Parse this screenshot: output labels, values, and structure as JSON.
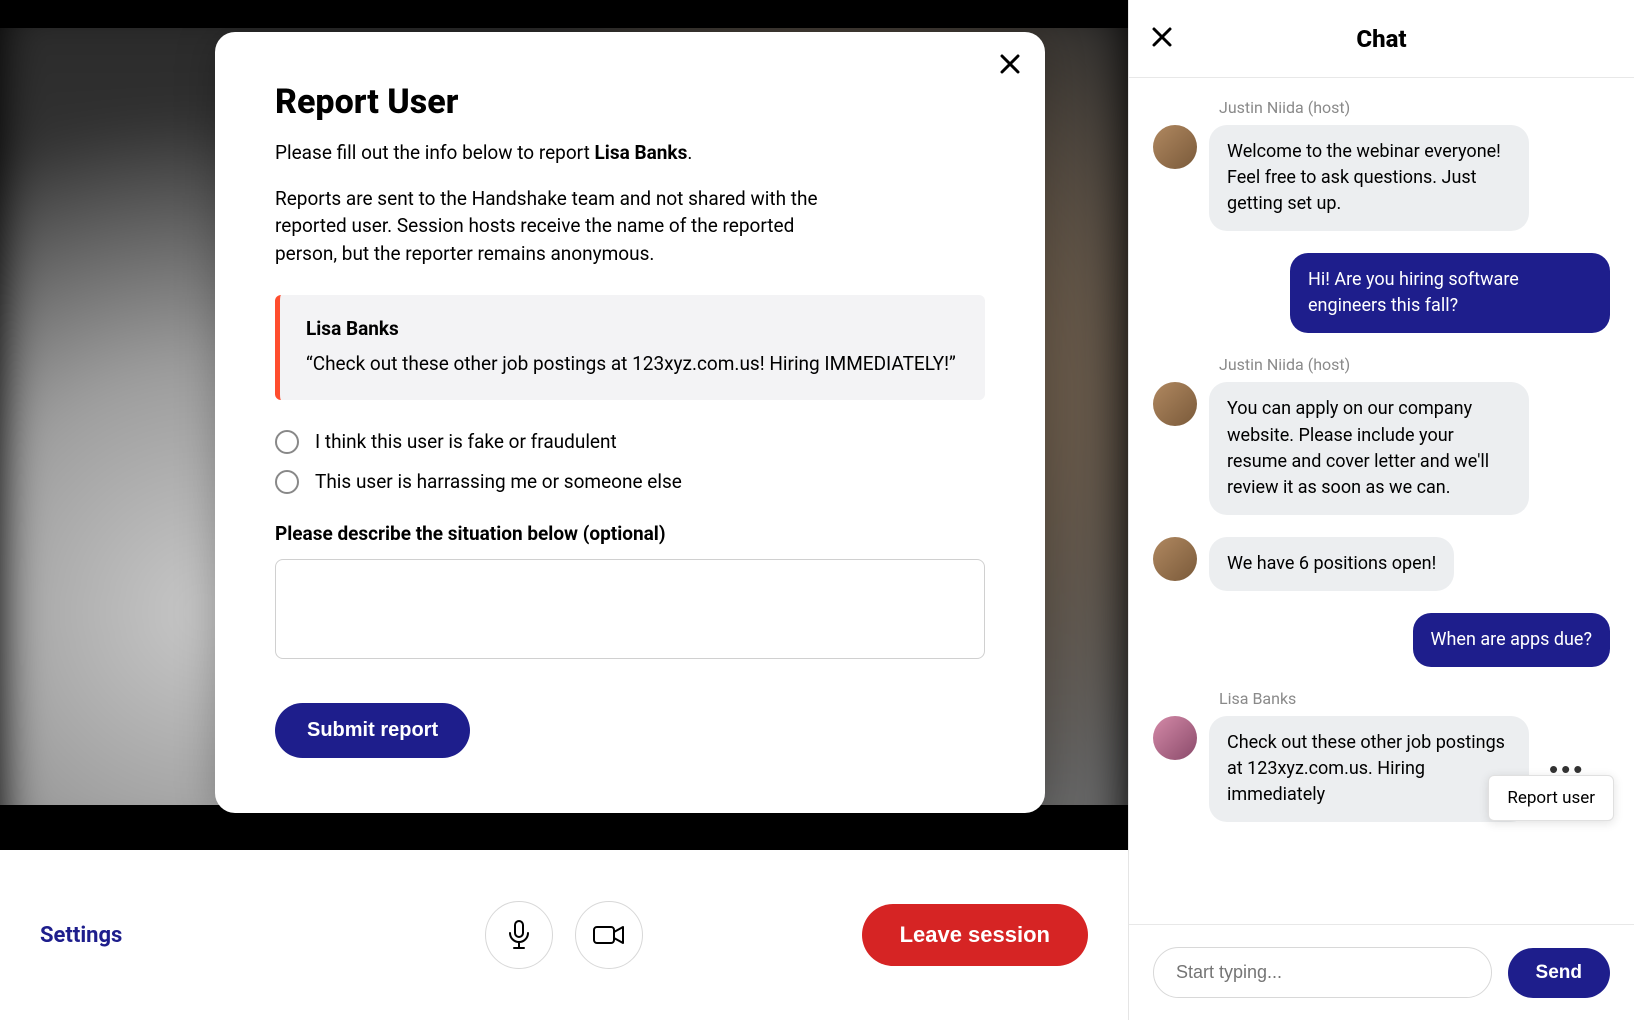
{
  "modal": {
    "title": "Report User",
    "subtext_prefix": "Please fill out the info below to report ",
    "reported_name": "Lisa Banks",
    "subtext_suffix": ".",
    "info": "Reports are sent to the Handshake team and not shared with the reported user. Session hosts receive the name of the reported person, but the reporter remains anonymous.",
    "quote": {
      "name": "Lisa Banks",
      "text": "“Check out these other job postings at 123xyz.com.us! Hiring IMMEDIATELY!”"
    },
    "options": [
      "I think this user is fake or fraudulent",
      "This user is harrassing me or someone else"
    ],
    "describe_label": "Please describe the situation below",
    "describe_optional": "  (optional)",
    "submit": "Submit report"
  },
  "controls": {
    "settings": "Settings",
    "leave": "Leave session"
  },
  "chat": {
    "title": "Chat",
    "messages": [
      {
        "author": "Justin Niida (host)",
        "text": "Welcome to the webinar everyone! Feel free to ask questions. Just getting set up.",
        "sent": false,
        "avatar": "justin"
      },
      {
        "author": "",
        "text": "Hi! Are you hiring software engineers this fall?",
        "sent": true
      },
      {
        "author": "Justin Niida (host)",
        "text": "You can apply on our company website. Please include your resume and cover letter and we'll review it as soon as we can.",
        "sent": false,
        "avatar": "justin"
      },
      {
        "author": "",
        "text": "We have 6 positions open!",
        "sent": false,
        "continued": true,
        "avatar": "justin"
      },
      {
        "author": "",
        "text": "When are apps due?",
        "sent": true
      },
      {
        "author": "Lisa Banks",
        "text": "Check out these other job postings at 123xyz.com.us. Hiring immediately",
        "sent": false,
        "avatar": "lisa",
        "has_more": true
      }
    ],
    "popover": "Report user",
    "input_placeholder": "Start typing...",
    "send": "Send"
  }
}
